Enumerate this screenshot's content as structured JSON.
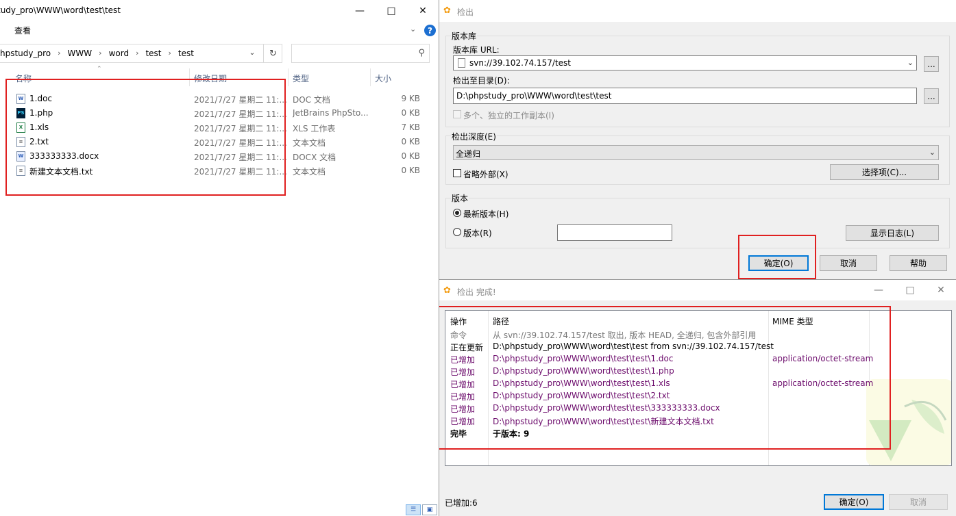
{
  "explorer": {
    "title": "tudy_pro\\WWW\\word\\test\\test",
    "ribbon_tab": "查看",
    "help_label": "?",
    "breadcrumbs": [
      "hpstudy_pro",
      "WWW",
      "word",
      "test",
      "test"
    ],
    "search_placeholder": "",
    "columns": {
      "name": "名称",
      "date": "修改日期",
      "type": "类型",
      "size": "大小"
    },
    "files": [
      {
        "name": "1.doc",
        "date": "2021/7/27 星期二 11:...",
        "type": "DOC 文档",
        "size": "9 KB",
        "icon": "doc-icon"
      },
      {
        "name": "1.php",
        "date": "2021/7/27 星期二 11:...",
        "type": "JetBrains PhpSto...",
        "size": "0 KB",
        "icon": "phpstorm-icon"
      },
      {
        "name": "1.xls",
        "date": "2021/7/27 星期二 11:...",
        "type": "XLS 工作表",
        "size": "7 KB",
        "icon": "xls-icon"
      },
      {
        "name": "2.txt",
        "date": "2021/7/27 星期二 11:...",
        "type": "文本文档",
        "size": "0 KB",
        "icon": "txt-icon"
      },
      {
        "name": "333333333.docx",
        "date": "2021/7/27 星期二 11:...",
        "type": "DOCX 文档",
        "size": "0 KB",
        "icon": "docx-icon"
      },
      {
        "name": "新建文本文档.txt",
        "date": "2021/7/27 星期二 11:...",
        "type": "文本文档",
        "size": "0 KB",
        "icon": "txt-icon"
      }
    ]
  },
  "checkout": {
    "title": "检出",
    "repo_group": "版本库",
    "url_label": "版本库 URL:",
    "url_value": "svn://39.102.74.157/test",
    "dir_label": "检出至目录(D):",
    "dir_value": "D:\\phpstudy_pro\\WWW\\word\\test\\test",
    "browse_label": "...",
    "multi_label": "多个、独立的工作副本(I)",
    "depth_label": "检出深度(E)",
    "depth_value": "全递归",
    "omit_externals_label": "省略外部(X)",
    "options_button": "选择项(C)...",
    "revision_group": "版本",
    "head_label": "最新版本(H)",
    "revision_label": "版本(R)",
    "revision_value": "",
    "show_log_button": "显示日志(L)",
    "ok_button": "确定(O)",
    "cancel_button": "取消",
    "help_button": "帮助"
  },
  "finished": {
    "title": "检出 完成!",
    "columns": {
      "action": "操作",
      "path": "路径",
      "mime": "MIME 类型"
    },
    "rows": [
      {
        "action": "命令",
        "path": "从 svn://39.102.74.157/test 取出, 版本 HEAD, 全递归, 包含外部引用",
        "mime": "",
        "style": "gray"
      },
      {
        "action": "正在更新",
        "path": "D:\\phpstudy_pro\\WWW\\word\\test\\test from svn://39.102.74.157/test",
        "mime": "",
        "style": "black"
      },
      {
        "action": "已增加",
        "path": "D:\\phpstudy_pro\\WWW\\word\\test\\test\\1.doc",
        "mime": "application/octet-stream",
        "style": "purple"
      },
      {
        "action": "已增加",
        "path": "D:\\phpstudy_pro\\WWW\\word\\test\\test\\1.php",
        "mime": "",
        "style": "purple"
      },
      {
        "action": "已增加",
        "path": "D:\\phpstudy_pro\\WWW\\word\\test\\test\\1.xls",
        "mime": "application/octet-stream",
        "style": "purple"
      },
      {
        "action": "已增加",
        "path": "D:\\phpstudy_pro\\WWW\\word\\test\\test\\2.txt",
        "mime": "",
        "style": "purple"
      },
      {
        "action": "已增加",
        "path": "D:\\phpstudy_pro\\WWW\\word\\test\\test\\333333333.docx",
        "mime": "",
        "style": "purple"
      },
      {
        "action": "已增加",
        "path": "D:\\phpstudy_pro\\WWW\\word\\test\\test\\新建文本文档.txt",
        "mime": "",
        "style": "purple"
      },
      {
        "action": "完毕",
        "path": "于版本: 9",
        "mime": "",
        "style": "bold"
      }
    ],
    "status": "已增加:6",
    "ok_button": "确定(O)",
    "cancel_button": "取消"
  },
  "colors": {
    "highlight": "#e02020",
    "added_text": "#6b0a6b",
    "accent": "#0078d7"
  }
}
